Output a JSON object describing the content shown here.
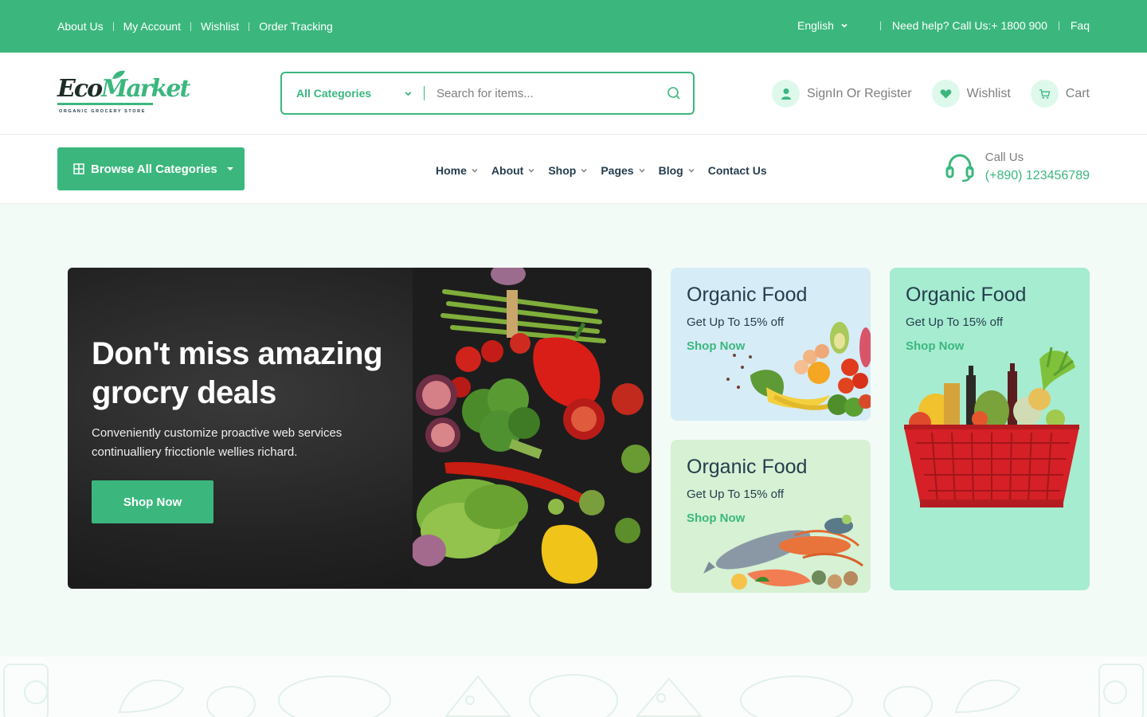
{
  "topbar": {
    "links": [
      "About Us",
      "My Account",
      "Wishlist",
      "Order Tracking"
    ],
    "language": "English",
    "help": "Need help? Call Us:+ 1800 900",
    "faq": "Faq"
  },
  "header": {
    "logo": {
      "brand_part1": "Eco",
      "brand_part2": "Market",
      "tagline": "ORGANIC GROCERY STORE"
    },
    "search": {
      "category": "All Categories",
      "placeholder": "Search for items..."
    },
    "actions": {
      "signin": "SignIn Or Register",
      "wishlist": "Wishlist",
      "cart": "Cart"
    }
  },
  "nav": {
    "browse_label": "Browse All Categories",
    "items": [
      "Home",
      "About",
      "Shop",
      "Pages",
      "Blog",
      "Contact Us"
    ],
    "call_label": "Call Us",
    "call_number": "(+890) 123456789"
  },
  "hero": {
    "title": "Don't miss amazing grocry deals",
    "text": "Conveniently customize proactive web services continualliery fricctionle wellies richard.",
    "button": "Shop Now"
  },
  "promos": [
    {
      "title": "Organic Food",
      "subtitle": "Get Up To 15% off",
      "link": "Shop Now",
      "background": "#d6ecf6"
    },
    {
      "title": "Organic Food",
      "subtitle": "Get Up To 15% off",
      "link": "Shop Now",
      "background": "#d6f1d3"
    },
    {
      "title": "Organic Food",
      "subtitle": "Get Up To 15% off",
      "link": "Shop Now",
      "background": "#a6ecd0"
    }
  ],
  "colors": {
    "accent": "#3bb77e",
    "heading": "#253d4e",
    "muted": "#7e7e7e"
  }
}
